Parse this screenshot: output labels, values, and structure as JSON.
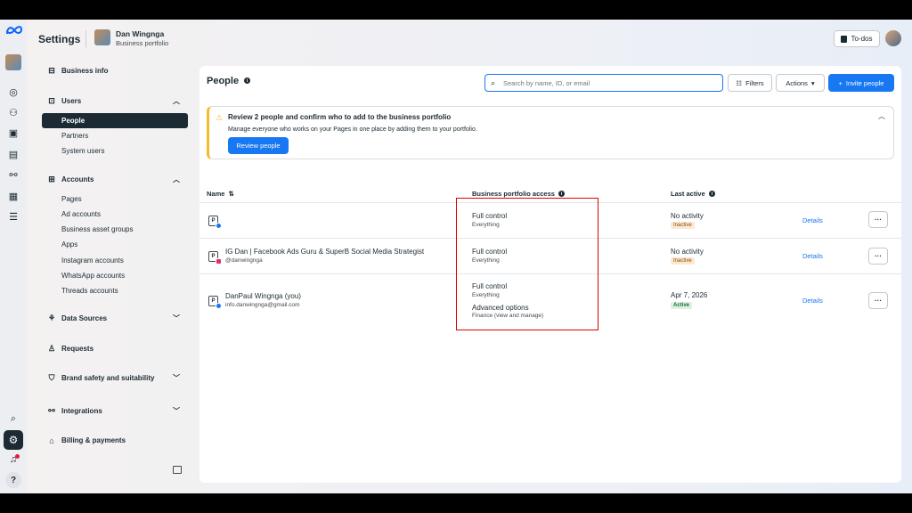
{
  "header": {
    "title": "Settings",
    "business_name": "Dan Wingnga",
    "business_sub": "Business portfolio",
    "todos_label": "To-dos"
  },
  "sidebar": {
    "business_info": "Business info",
    "users": "Users",
    "users_items": [
      "People",
      "Partners",
      "System users"
    ],
    "accounts": "Accounts",
    "accounts_items": [
      "Pages",
      "Ad accounts",
      "Business asset groups",
      "Apps",
      "Instagram accounts",
      "WhatsApp accounts",
      "Threads accounts"
    ],
    "data_sources": "Data Sources",
    "requests": "Requests",
    "brand_safety": "Brand safety and suitability",
    "integrations": "Integrations",
    "billing": "Billing & payments"
  },
  "main": {
    "title": "People",
    "search_placeholder": "Search by name, ID, or email",
    "filters_label": "Filters",
    "actions_label": "Actions",
    "invite_label": "Invite people",
    "banner": {
      "title": "Review 2 people and confirm who to add to the business portfolio",
      "text": "Manage everyone who works on your Pages in one place by adding them to your portfolio.",
      "button": "Review people"
    },
    "columns": [
      "Name",
      "Business portfolio access",
      "Last active"
    ],
    "rows": [
      {
        "name": "",
        "handle": "",
        "access1": "Full control",
        "access1_sub": "Everything",
        "last_active": "No activity",
        "status": "Inactive",
        "details": "Details"
      },
      {
        "name": "IG Dan | Facebook Ads Guru & SuperB Social Media Strategist",
        "handle": "@danwingnga",
        "access1": "Full control",
        "access1_sub": "Everything",
        "last_active": "No activity",
        "status": "Inactive",
        "details": "Details"
      },
      {
        "name": "DanPaul Wingnga (you)",
        "handle": "info.danwingnga@gmail.com",
        "access1": "Full control",
        "access1_sub": "Everything",
        "access2": "Advanced options",
        "access2_sub": "Finance (view and manage)",
        "last_active": "Apr 7, 2026",
        "status": "Active",
        "details": "Details"
      }
    ]
  },
  "colors": {
    "primary": "#1877f2",
    "dark": "#1c2b33",
    "warning": "#f7b928",
    "highlight": "#e00000"
  }
}
